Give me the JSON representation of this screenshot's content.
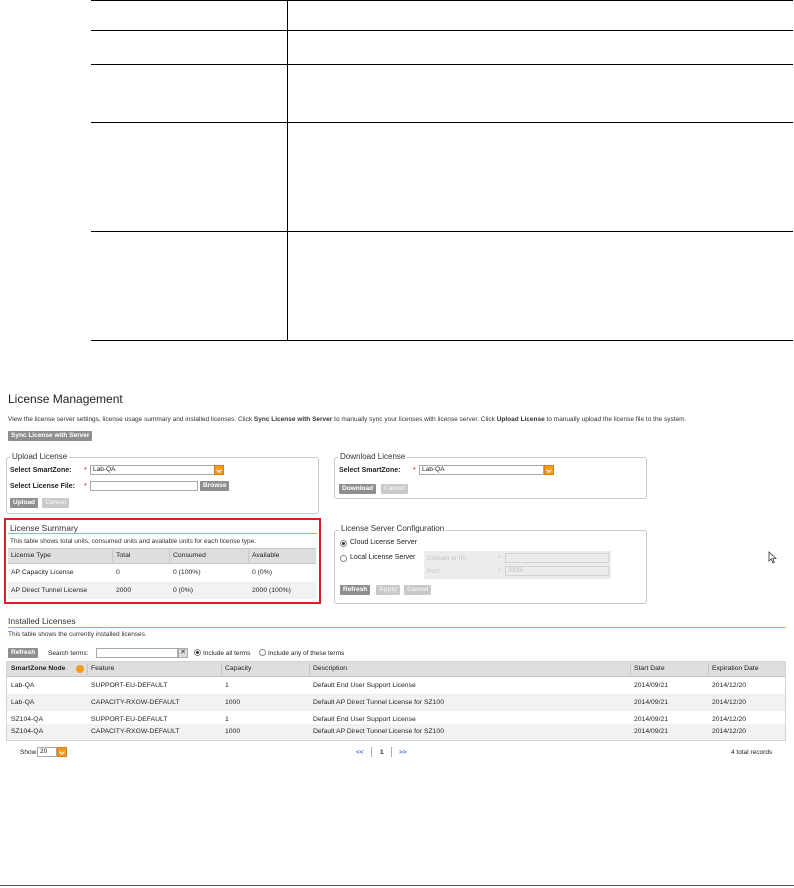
{
  "license_management": {
    "title": "License Management",
    "description_pre": "View the license server settings, license usage summary and installed licenses. Click ",
    "description_sync_bold": "Sync License with Server",
    "description_mid": " to manually sync your licenses with license server. Click ",
    "description_upload_bold": "Upload License",
    "description_post": " to manually upload the license file to the system.",
    "sync_button": "Sync License with Server"
  },
  "upload_license": {
    "legend": "Upload License",
    "smartzone_label": "Select SmartZone:",
    "smartzone_value": "Lab-QA",
    "file_label": "Select License File:",
    "file_value": "",
    "required_mark": "*",
    "browse_button": "Browse",
    "upload_button": "Upload",
    "cancel_button": "Cancel"
  },
  "download_license": {
    "legend": "Download License",
    "smartzone_label": "Select SmartZone:",
    "smartzone_value": "Lab-QA",
    "required_mark": "*",
    "download_button": "Download",
    "cancel_button": "Cancel"
  },
  "license_summary": {
    "legend": "License Summary",
    "description": "This table shows total units, consumed units and available units for each license type.",
    "columns": [
      "License Type",
      "Total",
      "Consumed",
      "Available"
    ],
    "rows": [
      [
        "AP Capacity License",
        "0",
        "0 (100%)",
        "0 (0%)"
      ],
      [
        "AP Direct Tunnel License",
        "2000",
        "0 (0%)",
        "2000 (100%)"
      ]
    ],
    "highlight_color": "#d9202a"
  },
  "license_server": {
    "legend": "License Server Configuration",
    "cloud_option": "Cloud License Server",
    "local_option": "Local License Server",
    "domain_label": "Domain or IP:",
    "port_label": "Port:",
    "port_value": "3333",
    "required_mark": "*",
    "refresh_button": "Refresh",
    "apply_button": "Apply",
    "cancel_button": "Cancel"
  },
  "installed_licenses": {
    "title": "Installed Licenses",
    "description": "This table shows the currently installed licenses.",
    "refresh_button": "Refresh",
    "search_label": "Search terms:",
    "search_value": "",
    "clear_symbol": "✕",
    "include_all": "Include all terms",
    "include_any": "Include any of these terms",
    "columns": [
      "SmartZone Node",
      "Feature",
      "Capacity",
      "Description",
      "Start Date",
      "Expiration Date"
    ],
    "rows": [
      [
        "Lab-QA",
        "SUPPORT-EU-DEFAULT",
        "1",
        "Default End User Support License",
        "2014/09/21",
        "2014/12/20"
      ],
      [
        "Lab-QA",
        "CAPACITY-RXGW-DEFAULT",
        "1000",
        "Default AP Direct Tunnel License for SZ100",
        "2014/09/21",
        "2014/12/20"
      ],
      [
        "SZ104-QA",
        "SUPPORT-EU-DEFAULT",
        "1",
        "Default End User Support License",
        "2014/09/21",
        "2014/12/20"
      ],
      [
        "SZ104-QA",
        "CAPACITY-RXGW-DEFAULT",
        "1000",
        "Default AP Direct Tunnel License for SZ100",
        "2014/09/21",
        "2014/12/20"
      ]
    ],
    "show_label": "Show",
    "page_size": "20",
    "pager_first": "<<",
    "pager_current": "1",
    "pager_last": ">>",
    "total_records": "4 total records",
    "accent_color": "#f49b1e"
  }
}
